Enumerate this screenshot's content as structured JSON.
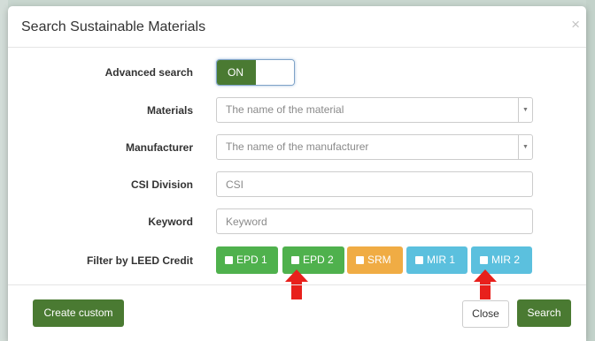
{
  "modal": {
    "title": "Search Sustainable Materials",
    "close_glyph": "×"
  },
  "form": {
    "advanced_search": {
      "label": "Advanced search",
      "toggle_value": "ON"
    },
    "materials": {
      "label": "Materials",
      "placeholder": "The name of the material"
    },
    "manufacturer": {
      "label": "Manufacturer",
      "placeholder": "The name of the manufacturer"
    },
    "csi_division": {
      "label": "CSI Division",
      "placeholder": "CSI"
    },
    "keyword": {
      "label": "Keyword",
      "placeholder": "Keyword"
    },
    "leed_filter": {
      "label": "Filter by LEED Credit",
      "credits": [
        {
          "label": "EPD 1",
          "color": "#4fb14d"
        },
        {
          "label": "EPD 2",
          "color": "#4fb14d"
        },
        {
          "label": "SRM",
          "color": "#f0ac44"
        },
        {
          "label": "MIR 1",
          "color": "#5bc0de"
        },
        {
          "label": "MIR 2",
          "color": "#5bc0de"
        }
      ]
    }
  },
  "footer": {
    "create_custom": "Create custom",
    "close": "Close",
    "search": "Search"
  },
  "icons": {
    "select_caret": "chevron-down-icon",
    "annotation": "arrow-up-icon"
  },
  "colors": {
    "primary_green": "#4a7a32",
    "annotation_red": "#e8201c"
  }
}
